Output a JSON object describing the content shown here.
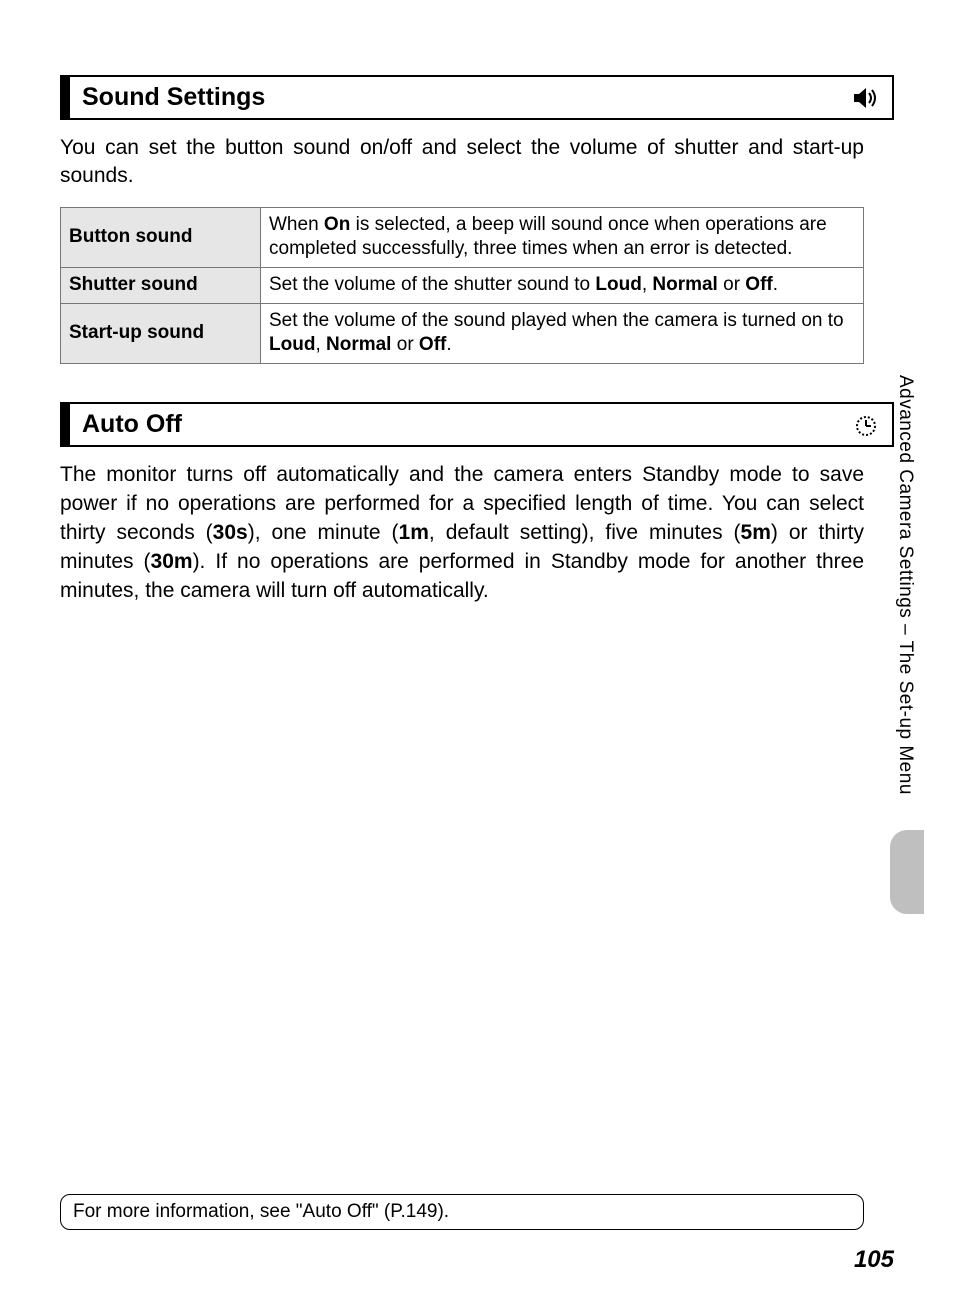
{
  "section1": {
    "title": "Sound Settings",
    "icon": "speaker-icon",
    "intro": "You can set the button sound on/off and select the volume of shutter and start-up sounds.",
    "rows": [
      {
        "label": "Button sound",
        "desc_pre": "When ",
        "desc_b1": "On",
        "desc_mid": " is selected, a beep will sound once when operations are completed successfully, three times when an error is detected.",
        "desc_b2": "",
        "desc_mid2": "",
        "desc_b3": "",
        "desc_mid3": "",
        "desc_b4": "",
        "desc_tail": ""
      },
      {
        "label": "Shutter sound",
        "desc_pre": "Set the volume of the shutter sound to ",
        "desc_b1": "Loud",
        "desc_mid": ", ",
        "desc_b2": "Normal",
        "desc_mid2": " or ",
        "desc_b3": "Off",
        "desc_mid3": ".",
        "desc_b4": "",
        "desc_tail": ""
      },
      {
        "label": "Start-up sound",
        "desc_pre": "Set the volume of the sound played when the camera is turned on to ",
        "desc_b1": "Loud",
        "desc_mid": ", ",
        "desc_b2": "Normal",
        "desc_mid2": " or ",
        "desc_b3": "Off",
        "desc_mid3": ".",
        "desc_b4": "",
        "desc_tail": ""
      }
    ]
  },
  "section2": {
    "title": "Auto Off",
    "icon": "timer-icon",
    "body_pre": "The monitor turns off automatically and the camera enters Standby mode to save power if no operations are performed for a specified length of time. You can select thirty seconds (",
    "b1": "30s",
    "mid1": "), one minute (",
    "b2": "1m",
    "mid2": ", default setting), five minutes (",
    "b3": "5m",
    "mid3": ") or thirty minutes (",
    "b4": "30m",
    "tail": "). If no operations are performed in Standby mode for another three minutes, the camera will turn off automatically."
  },
  "side_label": "Advanced Camera Settings – The Set-up Menu",
  "footnote": "For more information, see \"Auto Off\" (P.149).",
  "page_number": "105"
}
